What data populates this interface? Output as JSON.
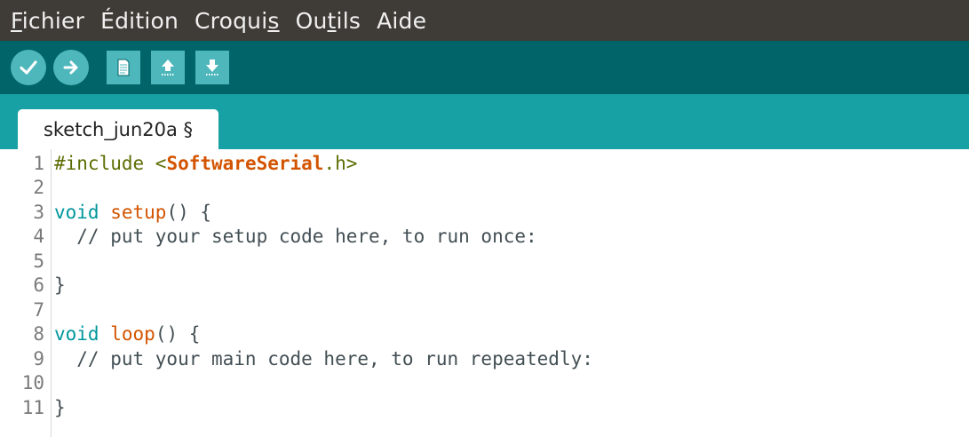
{
  "menubar": {
    "items": [
      {
        "underline": "F",
        "rest": "ichier"
      },
      {
        "underline": "",
        "rest": "Édition"
      },
      {
        "pre": "Croqui",
        "underline": "s",
        "rest": ""
      },
      {
        "pre": "Ou",
        "underline": "t",
        "rest": "ils"
      },
      {
        "underline": "",
        "rest": "Aide"
      }
    ]
  },
  "toolbar": {
    "buttons": [
      "verify-icon",
      "upload-icon",
      "new-icon",
      "open-icon",
      "save-icon"
    ]
  },
  "tab": {
    "label": "sketch_jun20a §"
  },
  "editor": {
    "lines": [
      {
        "num": "1",
        "segments": [
          {
            "t": "#include <",
            "c": "pre"
          },
          {
            "t": "SoftwareSerial",
            "c": "lib"
          },
          {
            "t": ".h>",
            "c": "pre"
          }
        ]
      },
      {
        "num": "2",
        "segments": []
      },
      {
        "num": "3",
        "segments": [
          {
            "t": "void",
            "c": "kw"
          },
          {
            "t": " ",
            "c": "code"
          },
          {
            "t": "setup",
            "c": "fn"
          },
          {
            "t": "() {",
            "c": "code"
          }
        ]
      },
      {
        "num": "4",
        "segments": [
          {
            "t": "  // put your setup code here, to run once:",
            "c": "cm"
          }
        ]
      },
      {
        "num": "5",
        "segments": []
      },
      {
        "num": "6",
        "segments": [
          {
            "t": "}",
            "c": "code"
          }
        ]
      },
      {
        "num": "7",
        "segments": []
      },
      {
        "num": "8",
        "segments": [
          {
            "t": "void",
            "c": "kw"
          },
          {
            "t": " ",
            "c": "code"
          },
          {
            "t": "loop",
            "c": "fn"
          },
          {
            "t": "() {",
            "c": "code"
          }
        ]
      },
      {
        "num": "9",
        "segments": [
          {
            "t": "  // put your main code here, to run repeatedly:",
            "c": "cm"
          }
        ]
      },
      {
        "num": "10",
        "segments": []
      },
      {
        "num": "11",
        "segments": [
          {
            "t": "}",
            "c": "code"
          }
        ]
      }
    ]
  },
  "colors": {
    "menubar_bg": "#3f3b37",
    "toolbar_bg": "#006468",
    "tabbar_bg": "#17a1a5",
    "button_bg": "#4db7bb",
    "keyword": "#00979c",
    "function": "#d35400"
  }
}
